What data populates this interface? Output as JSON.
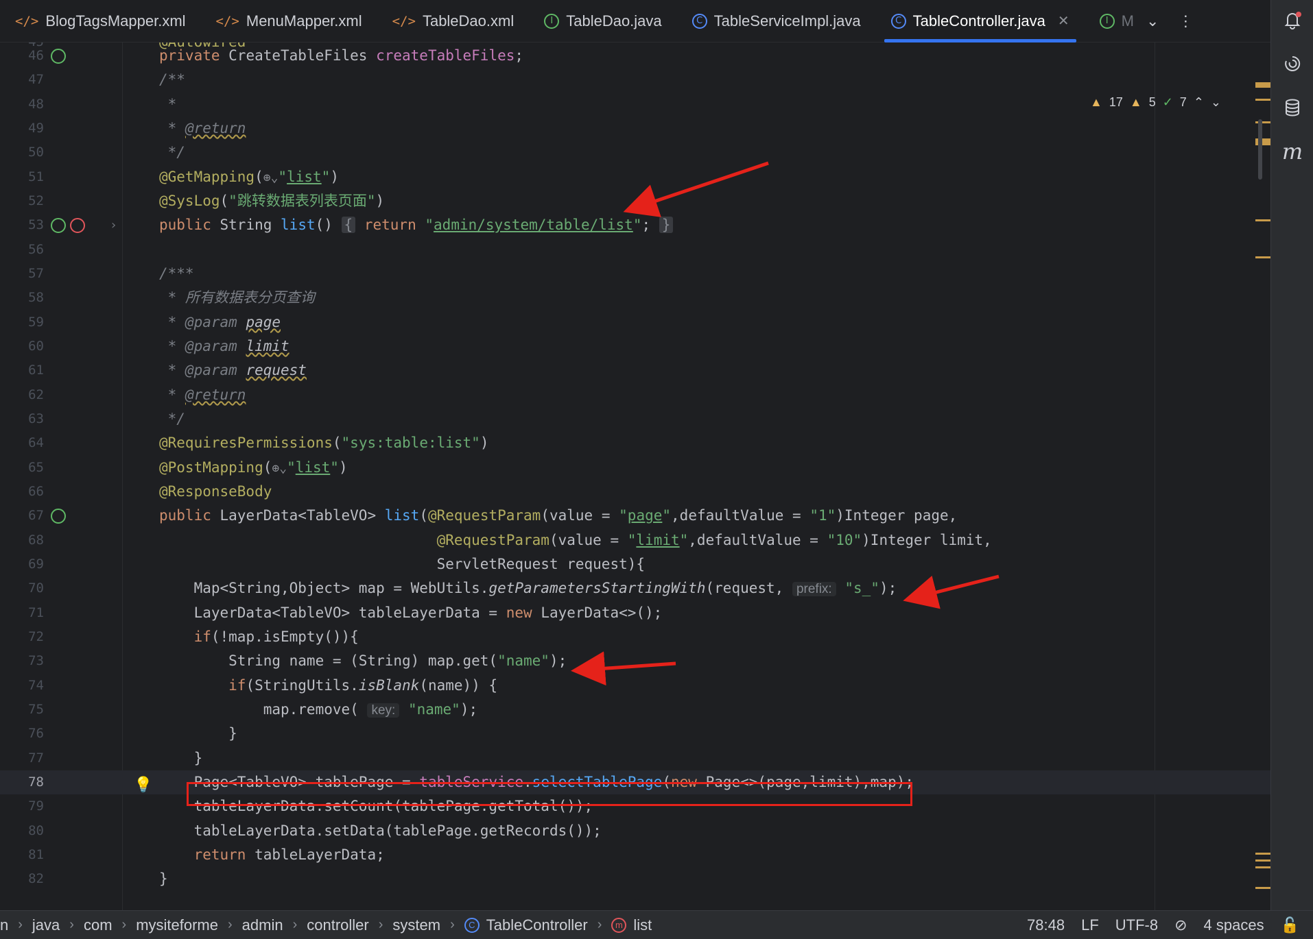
{
  "tabs": [
    {
      "label": "BlogTagsMapper.xml",
      "icon": "xml-file-icon"
    },
    {
      "label": "MenuMapper.xml",
      "icon": "xml-file-icon"
    },
    {
      "label": "TableDao.xml",
      "icon": "xml-file-icon"
    },
    {
      "label": "TableDao.java",
      "icon": "interface-icon"
    },
    {
      "label": "TableServiceImpl.java",
      "icon": "class-icon"
    },
    {
      "label": "TableController.java",
      "icon": "class-icon",
      "active": true
    },
    {
      "label": "M",
      "icon": "interface-icon"
    }
  ],
  "inspection": {
    "warnings_a": "17",
    "warnings_b": "5",
    "ok": "7"
  },
  "lines": {
    "l45": {
      "num": "45",
      "text": "@Autowired"
    },
    "l46": {
      "num": "46"
    },
    "l47": {
      "num": "47"
    },
    "l48": {
      "num": "48"
    },
    "l49": {
      "num": "49"
    },
    "l50": {
      "num": "50"
    },
    "l51": {
      "num": "51"
    },
    "l52": {
      "num": "52",
      "syslog": "\"跳转数据表列表页面\""
    },
    "l53": {
      "num": "53",
      "url": "admin/system/table/list"
    },
    "l56": {
      "num": "56"
    },
    "l57": {
      "num": "57"
    },
    "l58": {
      "num": "58",
      "comment": " * 所有数据表分页查询"
    },
    "l59": {
      "num": "59"
    },
    "l60": {
      "num": "60"
    },
    "l61": {
      "num": "61"
    },
    "l62": {
      "num": "62"
    },
    "l63": {
      "num": "63"
    },
    "l64": {
      "num": "64",
      "perm": "\"sys:table:list\""
    },
    "l65": {
      "num": "65"
    },
    "l66": {
      "num": "66"
    },
    "l67": {
      "num": "67"
    },
    "l68": {
      "num": "68"
    },
    "l69": {
      "num": "69"
    },
    "l70": {
      "num": "70",
      "hint": "prefix:",
      "prefix": "\"s_\""
    },
    "l71": {
      "num": "71"
    },
    "l72": {
      "num": "72"
    },
    "l73": {
      "num": "73"
    },
    "l74": {
      "num": "74"
    },
    "l75": {
      "num": "75",
      "hint": "key:"
    },
    "l76": {
      "num": "76"
    },
    "l77": {
      "num": "77"
    },
    "l78": {
      "num": "78"
    },
    "l79": {
      "num": "79"
    },
    "l80": {
      "num": "80"
    },
    "l81": {
      "num": "81"
    },
    "l82": {
      "num": "82"
    }
  },
  "breadcrumb": [
    "n",
    "java",
    "com",
    "mysiteforme",
    "admin",
    "controller",
    "system",
    "TableController",
    "list"
  ],
  "status": {
    "position": "78:48",
    "line_sep": "LF",
    "encoding": "UTF-8",
    "indent": "4 spaces"
  },
  "colors": {
    "accent": "#3574f0",
    "highlight_box": "#e5221a",
    "arrow": "#e5221a"
  }
}
